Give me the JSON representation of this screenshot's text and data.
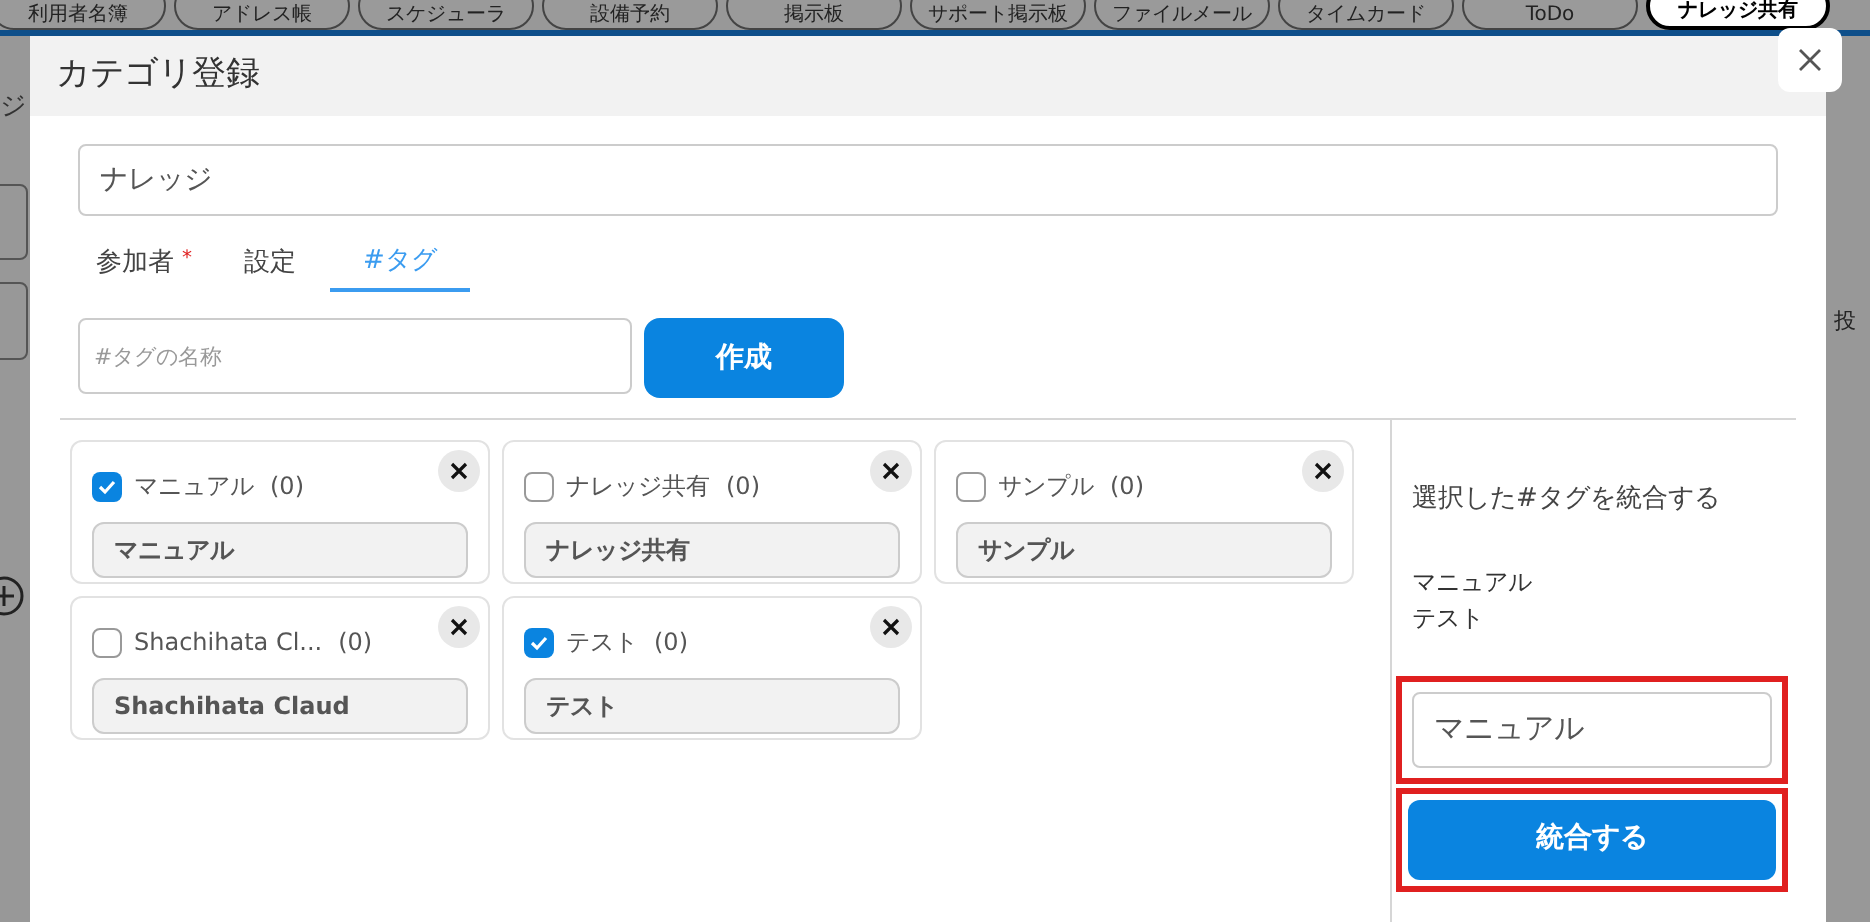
{
  "nav": [
    {
      "label": "利用者名簿",
      "selected": false
    },
    {
      "label": "アドレス帳",
      "selected": false
    },
    {
      "label": "スケジューラ",
      "selected": false
    },
    {
      "label": "設備予約",
      "selected": false
    },
    {
      "label": "掲示板",
      "selected": false
    },
    {
      "label": "サポート掲示板",
      "selected": false
    },
    {
      "label": "ファイルメール",
      "selected": false
    },
    {
      "label": "タイムカード",
      "selected": false
    },
    {
      "label": "ToDo",
      "selected": false
    },
    {
      "label": "ナレッジ共有",
      "selected": true
    }
  ],
  "background": {
    "left_text": "ジ",
    "right_text": "投"
  },
  "dialog": {
    "title": "カテゴリ登録",
    "name_value": "ナレッジ",
    "tabs": [
      {
        "label": "参加者",
        "required_mark": "*",
        "selected": false
      },
      {
        "label": "設定",
        "selected": false
      },
      {
        "label": "#タグ",
        "selected": true
      }
    ],
    "tag_placeholder": "#タグの名称",
    "create_button": "作成",
    "tags": [
      {
        "label": "マニュアル",
        "count": "(0)",
        "name": "マニュアル",
        "checked": true
      },
      {
        "label": "ナレッジ共有",
        "count": "(0)",
        "name": "ナレッジ共有",
        "checked": false
      },
      {
        "label": "サンプル",
        "count": "(0)",
        "name": "サンプル",
        "checked": false
      },
      {
        "label": "Shachihata Cl...",
        "count": "(0)",
        "name": "Shachihata Claud",
        "checked": false
      },
      {
        "label": "テスト",
        "count": "(0)",
        "name": "テスト",
        "checked": true
      }
    ],
    "merge": {
      "title": "選択した#タグを統合する",
      "selected_tags": [
        "マニュアル",
        "テスト"
      ],
      "value": "マニュアル",
      "button": "統合する"
    }
  }
}
